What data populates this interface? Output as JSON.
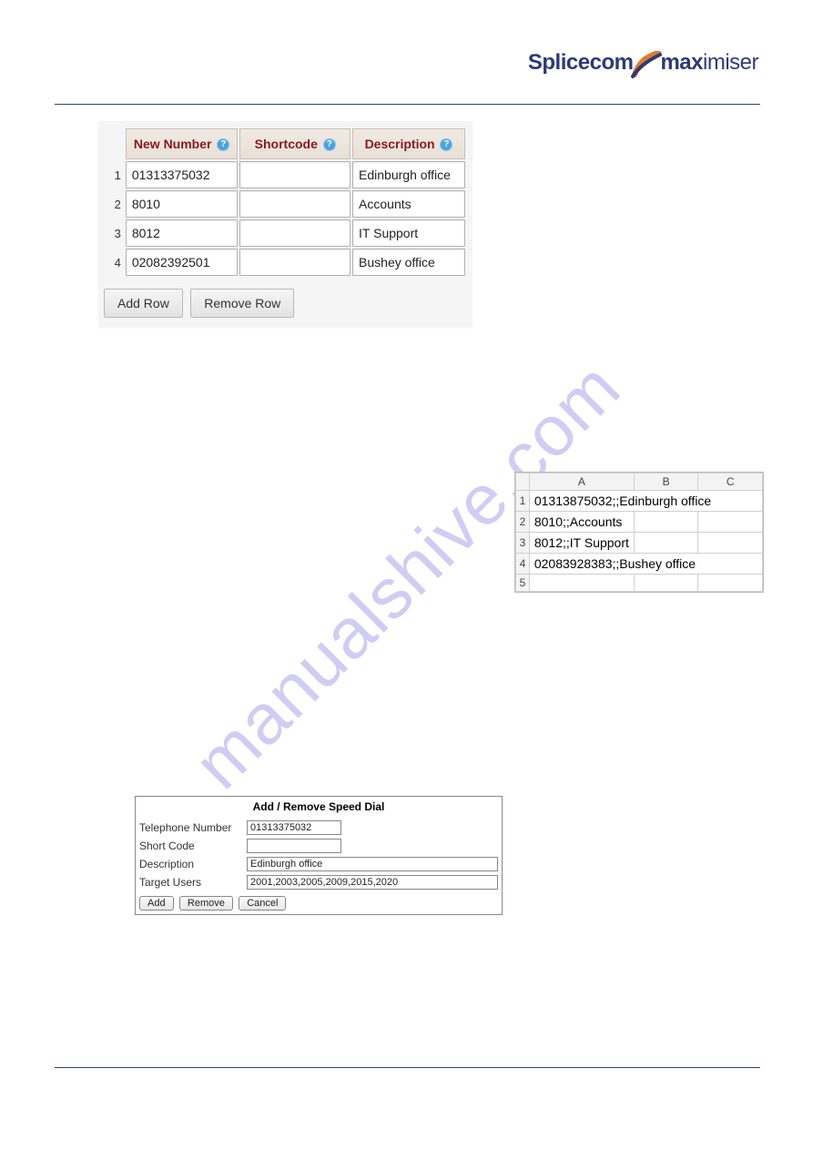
{
  "brand": {
    "part1": "Splice",
    "part2": "com",
    "part3": "max",
    "part4": "imiser"
  },
  "watermark": "manualshive.com",
  "panel1": {
    "headers": {
      "new_number": "New Number",
      "shortcode": "Shortcode",
      "description": "Description"
    },
    "help_glyph": "?",
    "rows": [
      {
        "idx": "1",
        "number": "01313375032",
        "shortcode": "",
        "description": "Edinburgh office"
      },
      {
        "idx": "2",
        "number": "8010",
        "shortcode": "",
        "description": "Accounts"
      },
      {
        "idx": "3",
        "number": "8012",
        "shortcode": "",
        "description": "IT Support"
      },
      {
        "idx": "4",
        "number": "02082392501",
        "shortcode": "",
        "description": "Bushey office"
      }
    ],
    "buttons": {
      "add_row": "Add Row",
      "remove_row": "Remove Row"
    }
  },
  "sheet": {
    "col_headers": {
      "a": "A",
      "b": "B",
      "c": "C"
    },
    "rows": [
      {
        "idx": "1",
        "a": "01313875032;;Edinburgh office",
        "b": "",
        "c": ""
      },
      {
        "idx": "2",
        "a": "8010;;Accounts",
        "b": "",
        "c": ""
      },
      {
        "idx": "3",
        "a": "8012;;IT Support",
        "b": "",
        "c": ""
      },
      {
        "idx": "4",
        "a": "02083928383;;Bushey office",
        "b": "",
        "c": ""
      },
      {
        "idx": "5",
        "a": "",
        "b": "",
        "c": ""
      }
    ]
  },
  "form2": {
    "title": "Add / Remove Speed Dial",
    "labels": {
      "telephone": "Telephone Number",
      "shortcode": "Short Code",
      "description": "Description",
      "target_users": "Target Users"
    },
    "values": {
      "telephone": "01313375032",
      "shortcode": "",
      "description": "Edinburgh office",
      "target_users": "2001,2003,2005,2009,2015,2020"
    },
    "buttons": {
      "add": "Add",
      "remove": "Remove",
      "cancel": "Cancel"
    }
  }
}
